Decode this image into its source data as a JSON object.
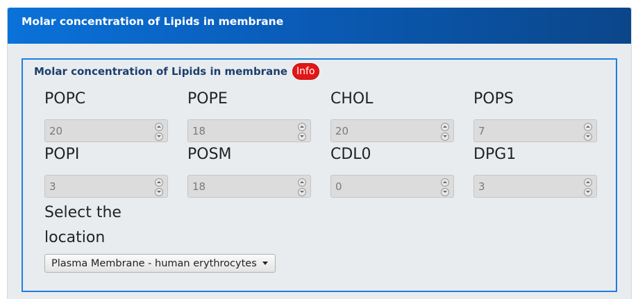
{
  "header": {
    "title": "Molar concentration of Lipids in membrane"
  },
  "fieldset": {
    "legend": "Molar concentration of Lipids in membrane",
    "info_label": "Info"
  },
  "lipids": [
    {
      "label": "POPC",
      "value": "20"
    },
    {
      "label": "POPE",
      "value": "18"
    },
    {
      "label": "CHOL",
      "value": "20"
    },
    {
      "label": "POPS",
      "value": "7"
    },
    {
      "label": "POPI",
      "value": "3"
    },
    {
      "label": "POSM",
      "value": "18"
    },
    {
      "label": "CDL0",
      "value": "0"
    },
    {
      "label": "DPG1",
      "value": "3"
    }
  ],
  "location": {
    "label_line1": "Select the",
    "label_line2": "location",
    "selected": "Plasma Membrane - human erythrocytes"
  },
  "colors": {
    "header_gradient_start": "#0a72d9",
    "header_gradient_end": "#0b468a",
    "fieldset_border": "#1e7ee0",
    "info_badge": "#e41616"
  }
}
